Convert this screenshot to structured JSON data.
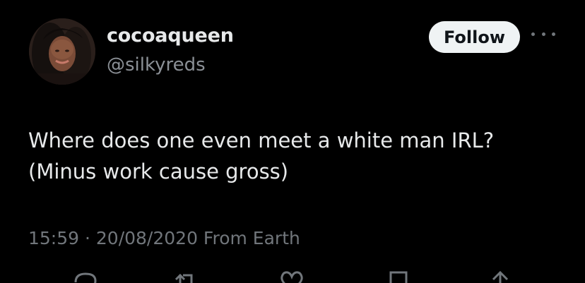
{
  "tweet": {
    "display_name": "cocoaqueen",
    "handle": "@silkyreds",
    "follow_label": "Follow",
    "text_lines": [
      "Where does one even meet a white man IRL?",
      "(Minus work cause gross)"
    ],
    "timestamp": "15:59 · 20/08/2020 From Earth"
  },
  "icons": {
    "more": "more-horizontal-icon",
    "reply": "reply-icon",
    "retweet": "retweet-icon",
    "like": "heart-icon",
    "bookmark": "bookmark-icon",
    "share": "share-icon"
  },
  "colors": {
    "background": "#000000",
    "primary_text": "#e7e9ea",
    "secondary_text": "#71767b",
    "follow_button_bg": "#eff3f4",
    "follow_button_text": "#0f1419"
  }
}
